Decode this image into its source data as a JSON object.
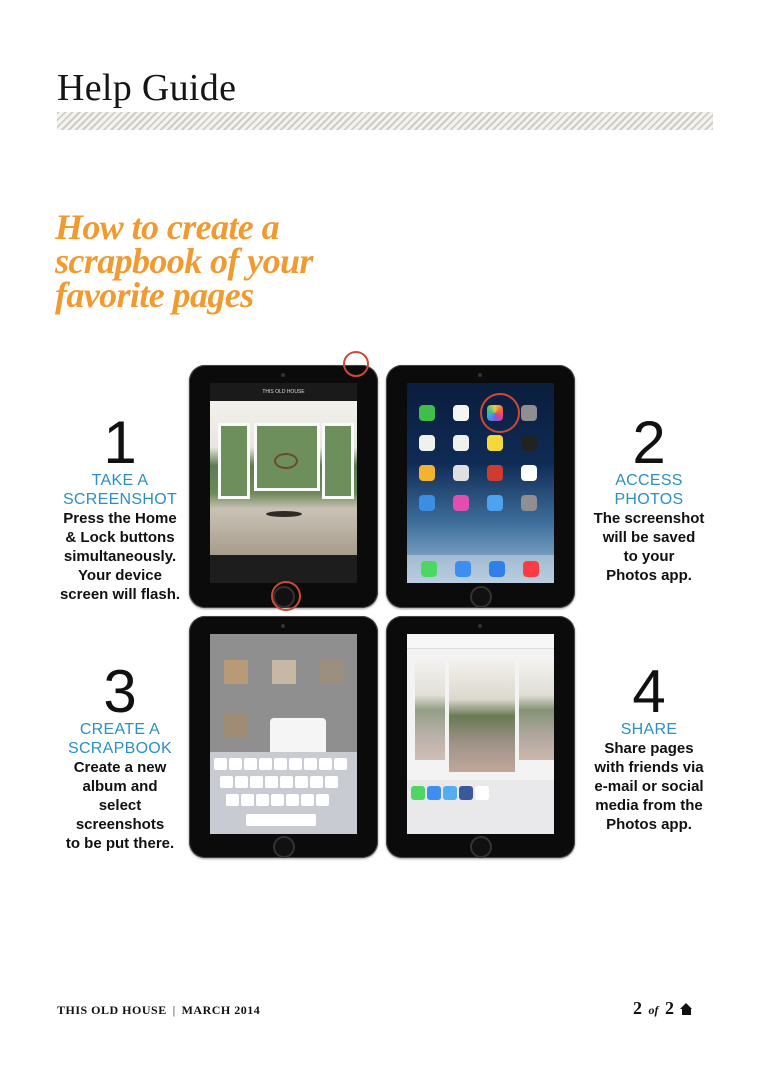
{
  "header": {
    "title": "Help Guide"
  },
  "headline": {
    "lines": [
      "How to create a",
      "scrapbook of your",
      "favorite pages"
    ]
  },
  "steps": [
    {
      "number": "1",
      "label_lines": [
        "TAKE A",
        "SCREENSHOT"
      ],
      "desc_lines": [
        "Press the Home",
        "& Lock buttons",
        "simultaneously.",
        "Your device",
        "screen will flash."
      ]
    },
    {
      "number": "2",
      "label_lines": [
        "ACCESS",
        "PHOTOS"
      ],
      "desc_lines": [
        "The screenshot",
        "will be saved",
        "to your",
        "Photos app."
      ]
    },
    {
      "number": "3",
      "label_lines": [
        "CREATE A",
        "SCRAPBOOK"
      ],
      "desc_lines": [
        "Create a new",
        "album and",
        "select",
        "screenshots",
        "to be put there."
      ]
    },
    {
      "number": "4",
      "label_lines": [
        "SHARE"
      ],
      "desc_lines": [
        "Share pages",
        "with friends via",
        "e-mail or social",
        "media from the",
        "Photos app."
      ]
    }
  ],
  "screens": {
    "s1_header": "THIS OLD HOUSE"
  },
  "footer": {
    "publication": "THIS OLD HOUSE",
    "issue": "MARCH 2014",
    "page_current": "2",
    "page_of": "of",
    "page_total": "2"
  },
  "colors": {
    "headline": "#f19a2f",
    "step_label": "#2a90c6",
    "highlight_circle": "#cc4a35"
  }
}
